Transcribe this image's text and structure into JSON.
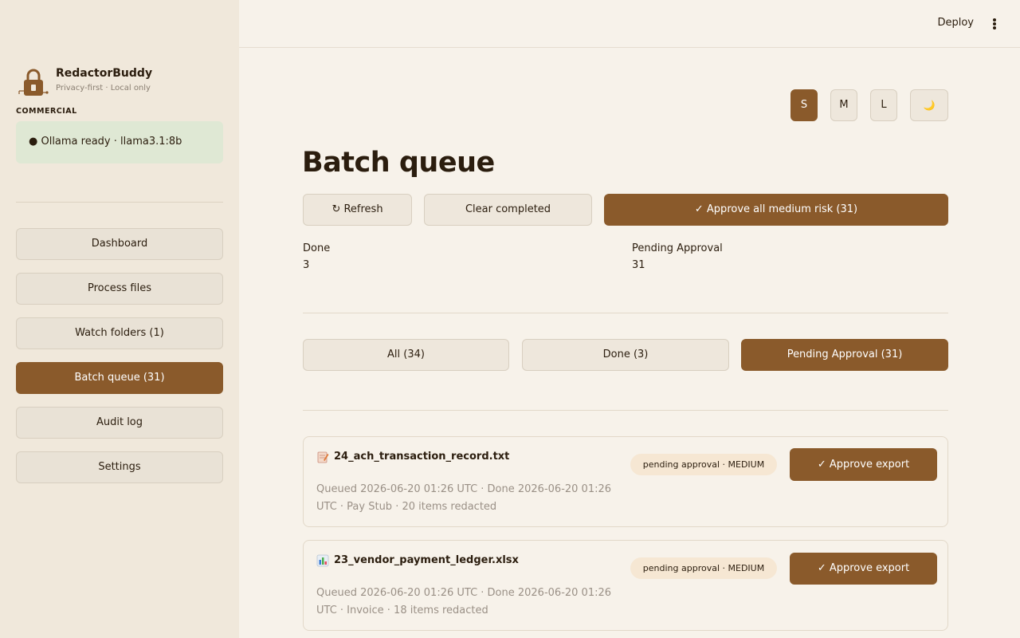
{
  "app": {
    "name": "RedactorBuddy",
    "tagline": "Privacy-first · Local only",
    "tier": "COMMERCIAL",
    "status": "● Ollama ready · llama3.1:8b"
  },
  "nav": {
    "items": [
      {
        "label": "Dashboard",
        "active": false
      },
      {
        "label": "Process files",
        "active": false
      },
      {
        "label": "Watch folders (1)",
        "active": false
      },
      {
        "label": "Batch queue (31)",
        "active": true
      },
      {
        "label": "Audit log",
        "active": false
      },
      {
        "label": "Settings",
        "active": false
      }
    ]
  },
  "topbar": {
    "deploy_label": "Deploy",
    "menu_icon": "kebab-menu-icon"
  },
  "size_controls": {
    "small": "S",
    "medium": "M",
    "large": "L",
    "theme_icon": "🌙",
    "selected": "S"
  },
  "page": {
    "title": "Batch queue"
  },
  "actions": {
    "refresh": "↻ Refresh",
    "clear": "Clear completed",
    "approve_all": "✓ Approve all medium risk (31)"
  },
  "metrics": {
    "done_label": "Done",
    "done_value": "3",
    "pending_label": "Pending Approval",
    "pending_value": "31"
  },
  "filters": {
    "all": "All (34)",
    "done": "Done (3)",
    "pending": "Pending Approval (31)",
    "selected": "pending"
  },
  "queue": [
    {
      "icon": "📝",
      "file": "24_ach_transaction_record.txt",
      "meta": "Queued 2026-06-20 01:26 UTC · Done 2026-06-20 01:26 UTC · Pay Stub · 20 items redacted",
      "badge": "pending approval · MEDIUM",
      "action": "✓ Approve export"
    },
    {
      "icon": "📊",
      "file": "23_vendor_payment_ledger.xlsx",
      "meta": "Queued 2026-06-20 01:26 UTC · Done 2026-06-20 01:26 UTC · Invoice · 18 items redacted",
      "badge": "pending approval · MEDIUM",
      "action": "✓ Approve export"
    }
  ],
  "colors": {
    "accent": "#8a5a2b",
    "sidebar_bg": "#f0e8db",
    "page_bg": "#f7f2ea",
    "status_bg": "#dfe8d4",
    "badge_bg": "#f6e7d3"
  }
}
